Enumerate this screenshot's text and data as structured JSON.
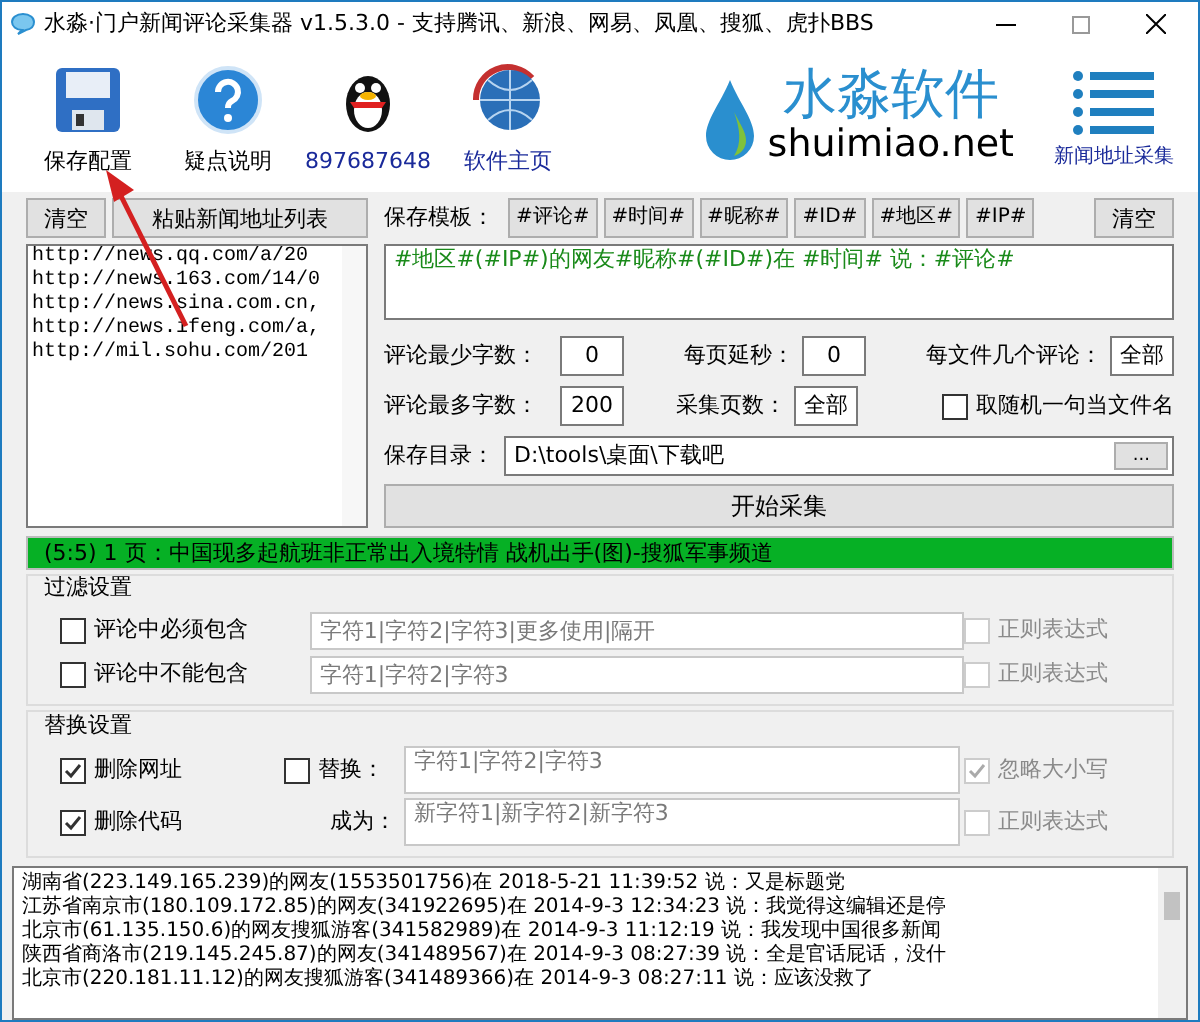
{
  "window": {
    "title": "水淼·门户新闻评论采集器 v1.5.3.0 - 支持腾讯、新浪、网易、凤凰、搜狐、虎扑BBS"
  },
  "toolbar": [
    {
      "kind": "save",
      "label": "保存配置"
    },
    {
      "kind": "help",
      "label": "疑点说明"
    },
    {
      "kind": "penguin",
      "label": "897687648"
    },
    {
      "kind": "globe",
      "label": "软件主页"
    }
  ],
  "logo": {
    "name": "水淼软件",
    "domain": "shuimiao.net"
  },
  "url_collect": {
    "label": "新闻地址采集"
  },
  "url_panel": {
    "clear": "清空",
    "paste": "粘贴新闻地址列表",
    "urls": [
      "http://news.qq.com/a/20",
      "http://news.163.com/14/0",
      "http://news.sina.com.cn,",
      "http://news.ifeng.com/a,",
      "http://mil.sohu.com/201"
    ]
  },
  "template": {
    "label": "保存模板：",
    "tags": [
      "#评论#",
      "#时间#",
      "#昵称#",
      "#ID#",
      "#地区#",
      "#IP#"
    ],
    "clear": "清空",
    "value": "#地区#(#IP#)的网友#昵称#(#ID#)在 #时间# 说：#评论#"
  },
  "settings": [
    {
      "label": "评论最少字数：",
      "value": "0"
    },
    {
      "label": "每页延秒：",
      "value": "0"
    },
    {
      "label": "每文件几个评论：",
      "value": "全部"
    },
    {
      "label": "评论最多字数：",
      "value": "200"
    },
    {
      "label": "采集页数：",
      "value": "全部"
    }
  ],
  "random_name": {
    "label": "取随机一句当文件名",
    "checked": false
  },
  "save_dir": {
    "label": "保存目录：",
    "value": "D:\\tools\\桌面\\下载吧",
    "browse": "..."
  },
  "start": "开始采集",
  "status": {
    "text": "(5:5) 1 页：中国现多起航班非正常出入境特情 战机出手(图)-搜狐军事频道",
    "level": 1
  },
  "filter": {
    "title": "过滤设置",
    "rows": [
      {
        "label": "评论中必须包含",
        "checked": false,
        "placeholder": "字符1|字符2|字符3|更多使用|隔开",
        "regex": {
          "label": "正则表达式",
          "checked": false,
          "disabled": true
        }
      },
      {
        "label": "评论中不能包含",
        "checked": false,
        "placeholder": "字符1|字符2|字符3",
        "regex": {
          "label": "正则表达式",
          "checked": false,
          "disabled": true
        }
      }
    ]
  },
  "replace": {
    "title": "替换设置",
    "remove_url": {
      "label": "删除网址",
      "checked": true
    },
    "remove_code": {
      "label": "删除代码",
      "checked": true
    },
    "replace": {
      "label": "替换：",
      "checked": false,
      "placeholder": "字符1|字符2|字符3"
    },
    "become": {
      "label": "成为：",
      "placeholder": "新字符1|新字符2|新字符3"
    },
    "ignore_case": {
      "label": "忽略大小写",
      "checked": true,
      "disabled": true
    },
    "regex": {
      "label": "正则表达式",
      "checked": false,
      "disabled": true
    }
  },
  "log": [
    "湖南省(223.149.165.239)的网友(1553501756)在 2018-5-21 11:39:52 说：又是标题党",
    "江苏省南京市(180.109.172.85)的网友(341922695)在 2014-9-3 12:34:23 说：我觉得这编辑还是停",
    "北京市(61.135.150.6)的网友搜狐游客(341582989)在 2014-9-3 11:12:19 说：我发现中国很多新闻",
    "陕西省商洛市(219.145.245.87)的网友(341489567)在 2014-9-3 08:27:39 说：全是官话屁话，没什",
    "北京市(220.181.11.12)的网友搜狐游客(341489366)在 2014-9-3 08:27:11 说：应该没救了"
  ]
}
